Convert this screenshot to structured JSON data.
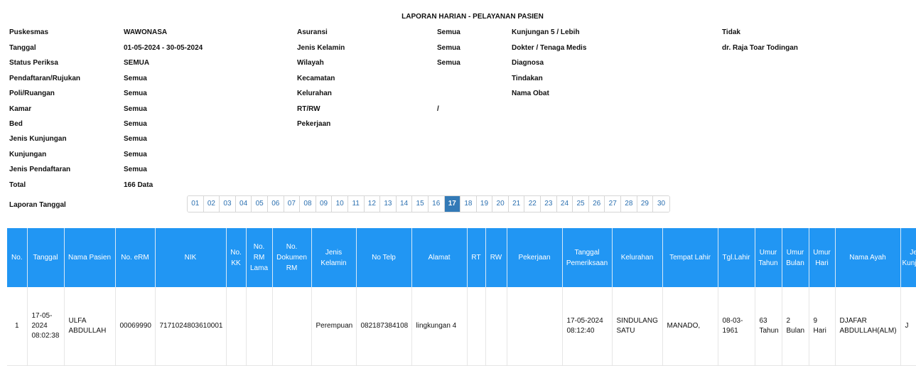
{
  "report": {
    "title": "LAPORAN HARIAN - PELAYANAN PASIEN"
  },
  "info": {
    "col1": [
      {
        "label": "Puskesmas",
        "value": "WAWONASA"
      },
      {
        "label": "Tanggal",
        "value": "01-05-2024 - 30-05-2024"
      },
      {
        "label": "Status Periksa",
        "value": "SEMUA"
      },
      {
        "label": "Pendaftaran/Rujukan",
        "value": "Semua"
      },
      {
        "label": "Poli/Ruangan",
        "value": "Semua"
      },
      {
        "label": "Kamar",
        "value": "Semua"
      },
      {
        "label": "Bed",
        "value": "Semua"
      },
      {
        "label": "Jenis Kunjungan",
        "value": "Semua"
      },
      {
        "label": "Kunjungan",
        "value": "Semua"
      },
      {
        "label": "Jenis Pendaftaran",
        "value": "Semua"
      },
      {
        "label": "Total",
        "value": "166 Data"
      }
    ],
    "col2": [
      {
        "label": "Asuransi",
        "value": "Semua"
      },
      {
        "label": "Jenis Kelamin",
        "value": "Semua"
      },
      {
        "label": "Wilayah",
        "value": "Semua"
      },
      {
        "label": "Kecamatan",
        "value": ""
      },
      {
        "label": "Kelurahan",
        "value": ""
      },
      {
        "label": "RT/RW",
        "value": "/"
      },
      {
        "label": "Pekerjaan",
        "value": ""
      }
    ],
    "col3": [
      {
        "label": "Kunjungan 5 / Lebih",
        "value": "Tidak"
      },
      {
        "label": "Dokter / Tenaga Medis",
        "value": "dr. Raja Toar Todingan"
      },
      {
        "label": "Diagnosa",
        "value": ""
      },
      {
        "label": "Tindakan",
        "value": ""
      },
      {
        "label": "Nama Obat",
        "value": ""
      }
    ]
  },
  "pager": {
    "label": "Laporan Tanggal",
    "pages": [
      "01",
      "02",
      "03",
      "04",
      "05",
      "06",
      "07",
      "08",
      "09",
      "10",
      "11",
      "12",
      "13",
      "14",
      "15",
      "16",
      "17",
      "18",
      "19",
      "20",
      "21",
      "22",
      "23",
      "24",
      "25",
      "26",
      "27",
      "28",
      "29",
      "30"
    ],
    "active": "17"
  },
  "table": {
    "headers": [
      "No.",
      "Tanggal",
      "Nama Pasien",
      "No. eRM",
      "NIK",
      "No. KK",
      "No. RM Lama",
      "No. Dokumen RM",
      "Jenis Kelamin",
      "No Telp",
      "Alamat",
      "RT",
      "RW",
      "Pekerjaan",
      "Tanggal Pemeriksaan",
      "Kelurahan",
      "Tempat Lahir",
      "Tgl.Lahir",
      "Umur Tahun",
      "Umur Bulan",
      "Umur Hari",
      "Nama Ayah",
      "Jenis Kunjungan"
    ],
    "rows": [
      [
        "1",
        "17-05-2024 08:02:38",
        "ULFA ABDULLAH",
        "00069990",
        "7171024803610001",
        "",
        "",
        "",
        "Perempuan",
        "082187384108",
        "lingkungan 4",
        "",
        "",
        "",
        "17-05-2024 08:12:40",
        "SINDULANG SATU",
        "MANADO,",
        "08-03-1961",
        "63 Tahun",
        "2 Bulan",
        "9 Hari",
        "DJAFAR ABDULLAH(ALM)",
        "J"
      ]
    ]
  },
  "colors": {
    "header_bg": "#2196f3",
    "pager_active": "#337ab7"
  }
}
